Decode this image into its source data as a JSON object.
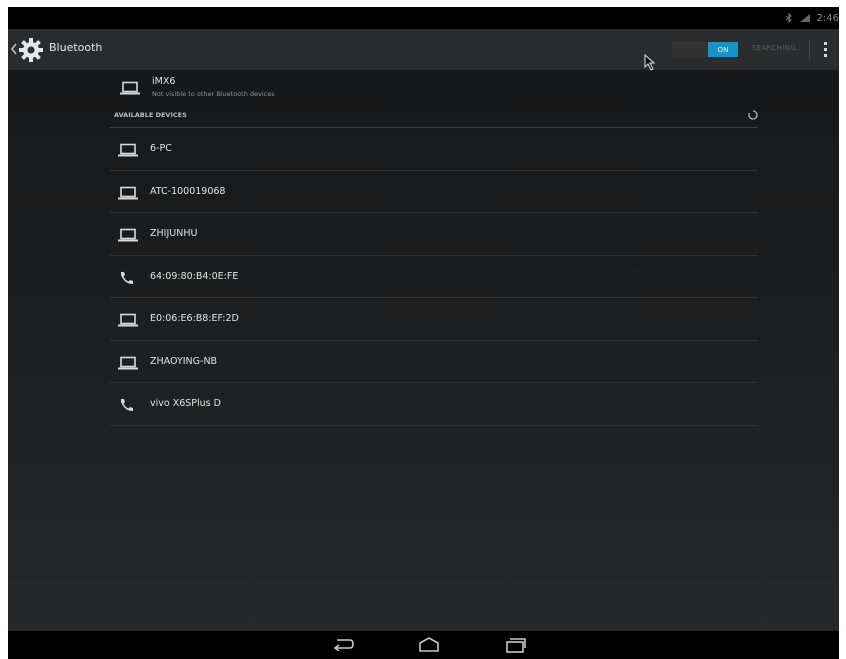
{
  "status_bar": {
    "time": "2:46",
    "icons": [
      "bluetooth-icon",
      "wifi-signal-icon"
    ]
  },
  "action_bar": {
    "title": "Bluetooth",
    "app_icon": "settings-gear-icon",
    "toggle_label": "ON",
    "searching_label": "SEARCHING...",
    "overflow_icon": "more-vert-icon"
  },
  "this_device": {
    "name": "iMX6",
    "subtitle": "Not visible to other Bluetooth devices",
    "icon": "laptop-icon"
  },
  "available_section": {
    "title": "AVAILABLE DEVICES",
    "icon": "progress-spinner-icon"
  },
  "devices": [
    {
      "label": "6-PC",
      "icon": "laptop-icon"
    },
    {
      "label": "ATC-100019068",
      "icon": "laptop-icon"
    },
    {
      "label": "ZHIJUNHU",
      "icon": "laptop-icon"
    },
    {
      "label": "64:09:80:B4:0E:FE",
      "icon": "phone-icon"
    },
    {
      "label": "E0:06:E6:B8:EF:2D",
      "icon": "laptop-icon"
    },
    {
      "label": "ZHAOYING-NB",
      "icon": "laptop-icon"
    },
    {
      "label": "vivo X6SPlus D",
      "icon": "phone-icon"
    }
  ],
  "nav_bar": {
    "buttons": [
      "back-icon",
      "home-icon",
      "recents-icon"
    ]
  },
  "colors": {
    "accent": "#1793c8",
    "background": "#1d2022",
    "action_bar": "#2a2c2e"
  }
}
